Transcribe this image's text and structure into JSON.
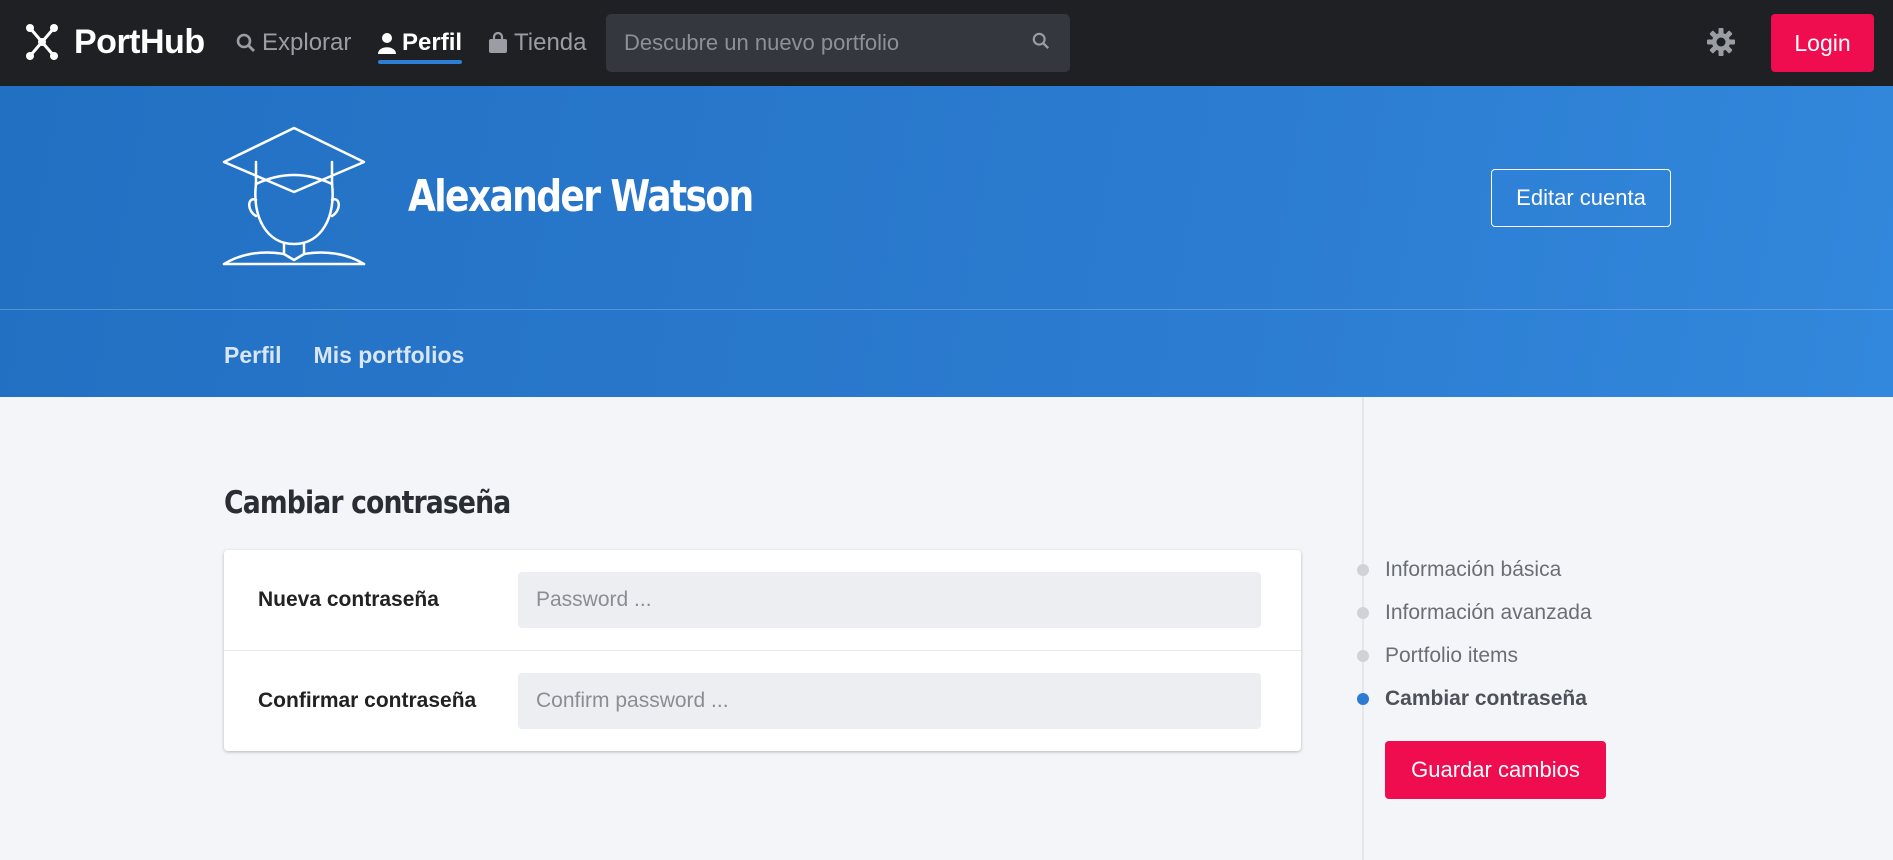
{
  "app": {
    "name": "PortHub"
  },
  "nav": {
    "items": [
      {
        "label": "Explorar",
        "icon": "search-icon"
      },
      {
        "label": "Perfil",
        "icon": "user-icon",
        "active": true
      },
      {
        "label": "Tienda",
        "icon": "bag-icon"
      }
    ],
    "search_placeholder": "Descubre un nuevo portfolio",
    "login_label": "Login"
  },
  "profile": {
    "name": "Alexander Watson",
    "edit_label": "Editar cuenta",
    "tabs": [
      "Perfil",
      "Mis portfolios"
    ]
  },
  "form": {
    "title": "Cambiar contraseña",
    "fields": [
      {
        "label": "Nueva contraseña",
        "placeholder": "Password ...",
        "value": ""
      },
      {
        "label": "Confirmar contraseña",
        "placeholder": "Confirm password ...",
        "value": ""
      }
    ]
  },
  "sidebar": {
    "items": [
      {
        "label": "Información básica",
        "active": false
      },
      {
        "label": "Información avanzada",
        "active": false
      },
      {
        "label": "Portfolio items",
        "active": false
      },
      {
        "label": "Cambiar contraseña",
        "active": true
      }
    ],
    "save_label": "Guardar cambios"
  },
  "colors": {
    "navbar": "#1e2024",
    "hero": "#2b7bd0",
    "accent": "#ef0c4f",
    "active_dot": "#2c7cd4"
  }
}
